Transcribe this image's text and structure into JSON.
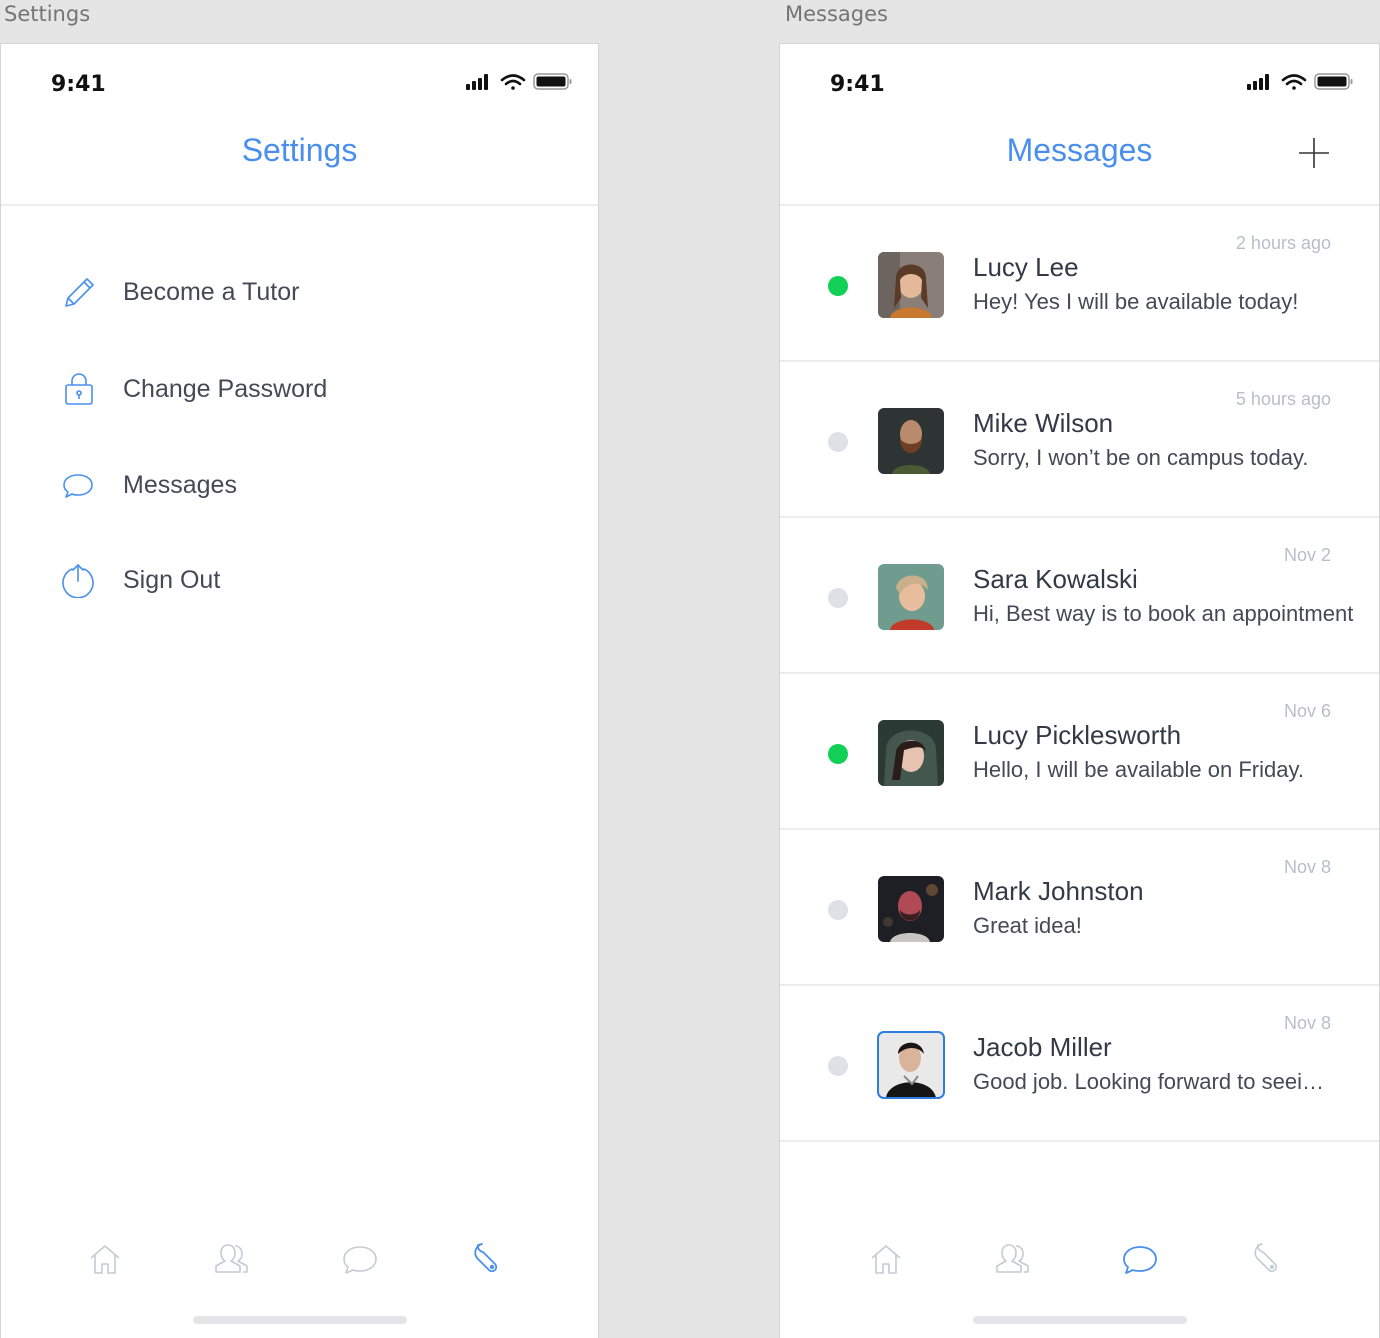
{
  "artboards": {
    "settings_label": "Settings",
    "messages_label": "Messages"
  },
  "colors": {
    "accent": "#4a8ff0",
    "online": "#12cf57",
    "offline": "#dee1e6",
    "tab_inactive": "#c5cad3"
  },
  "status_bar": {
    "time": "9:41"
  },
  "settings": {
    "title": "Settings",
    "items": [
      {
        "label": "Become a Tutor",
        "icon": "pencil-icon"
      },
      {
        "label": "Change Password",
        "icon": "lock-icon"
      },
      {
        "label": "Messages",
        "icon": "chat-bubble-icon"
      },
      {
        "label": "Sign Out",
        "icon": "sign-out-icon"
      }
    ]
  },
  "messages": {
    "title": "Messages",
    "add_icon": "plus-icon",
    "conversations": [
      {
        "name": "Lucy Lee",
        "message": "Hey! Yes I will be available today!",
        "time": "2 hours ago",
        "online": true
      },
      {
        "name": "Mike Wilson",
        "message": "Sorry, I won’t be on campus today.",
        "time": "5 hours ago",
        "online": false
      },
      {
        "name": "Sara Kowalski",
        "message": "Hi, Best way is to book an appointment",
        "time": "Nov 2",
        "online": false
      },
      {
        "name": "Lucy Picklesworth",
        "message": "Hello, I will be available on Friday.",
        "time": "Nov 6",
        "online": true
      },
      {
        "name": "Mark Johnston",
        "message": "Great idea!",
        "time": "Nov 8",
        "online": false
      },
      {
        "name": "Jacob Miller",
        "message": "Good job. Looking forward to seeing you",
        "time": "Nov 8",
        "online": false
      }
    ]
  },
  "tabbar": {
    "tabs": [
      "home-icon",
      "people-icon",
      "chat-bubble-icon",
      "wrench-icon"
    ],
    "settings_active": "wrench-icon",
    "messages_active": "chat-bubble-icon"
  }
}
